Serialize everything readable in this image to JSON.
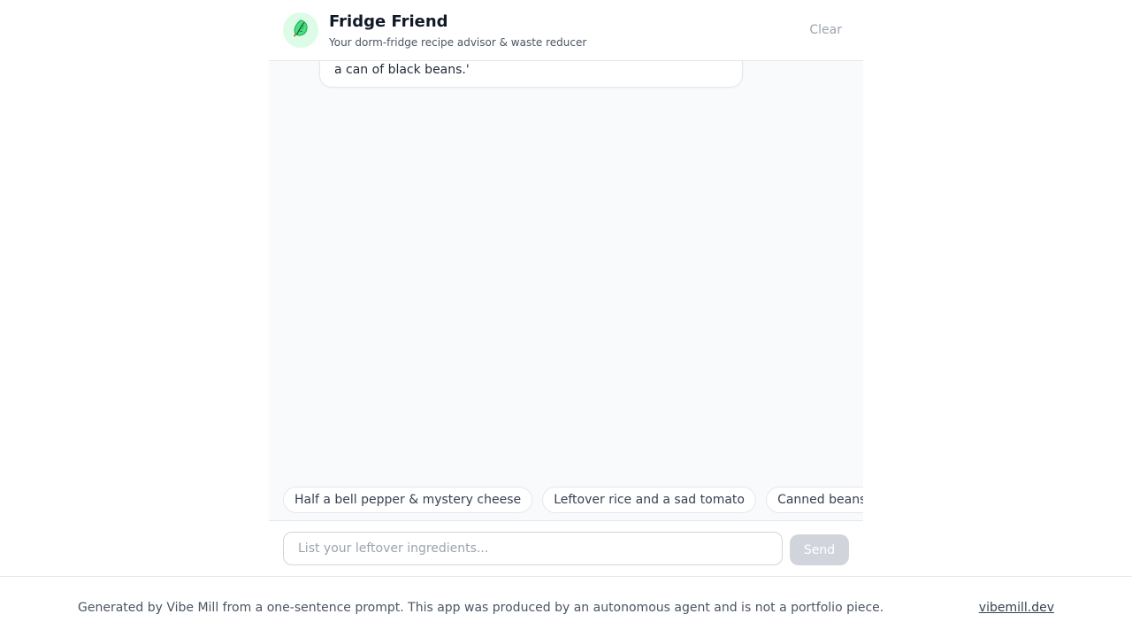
{
  "header": {
    "title": "Fridge Friend",
    "subtitle": "Your dorm-fridge recipe advisor & waste reducer",
    "clear_label": "Clear",
    "avatar_icon": "lettuce-icon"
  },
  "messages": [
    {
      "role": "assistant",
      "text": "suggest recipes to use them up — plus the carbon savings! For example: 'I have half a bell pepper, some mystery cheese, and a can of black beans.'"
    }
  ],
  "suggestions": [
    "Half a bell pepper & mystery cheese",
    "Leftover rice and a sad tomato",
    "Canned beans"
  ],
  "composer": {
    "placeholder": "List your leftover ingredients...",
    "value": "",
    "send_label": "Send"
  },
  "footer": {
    "text": "Generated by Vibe Mill from a one-sentence prompt. This app was produced by an autonomous agent and is not a portfolio piece.",
    "link_label": "vibemill.dev"
  },
  "colors": {
    "accent_bg": "#dcfce7",
    "leaf_green": "#4ade80",
    "send_disabled": "#d1d5db"
  }
}
